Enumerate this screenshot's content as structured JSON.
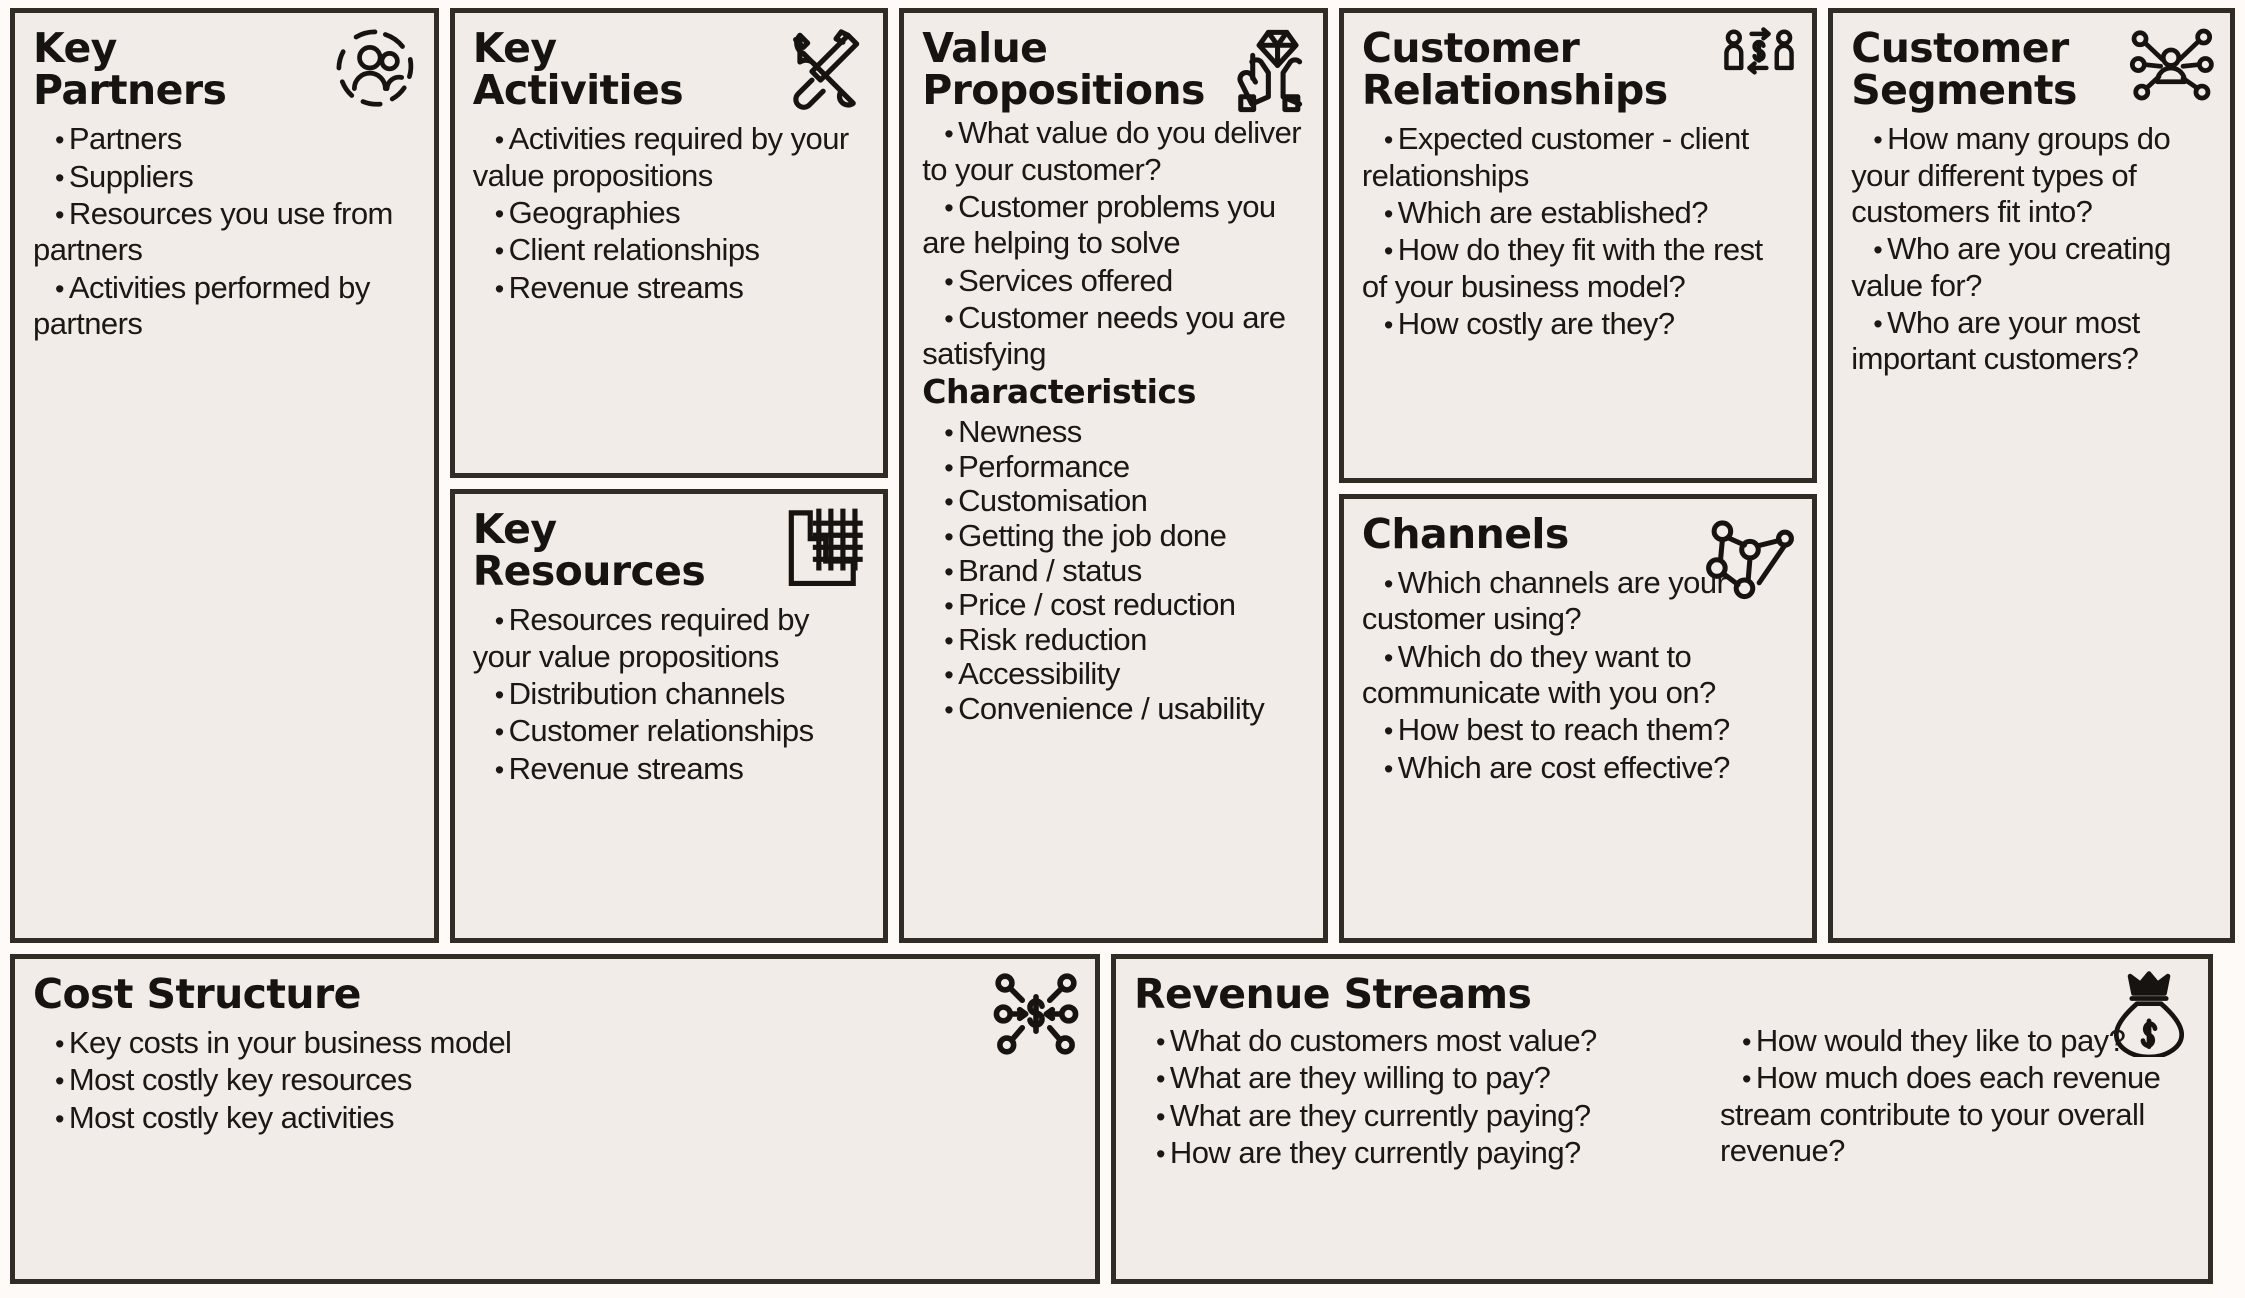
{
  "canvas": {
    "name": "Business Model Canvas",
    "background_color": "#fdfaf7",
    "block_background_color": "#f1ece8",
    "border_color": "#322c27",
    "text_color": "#1b1714"
  },
  "blocks": {
    "key_partners": {
      "title": "Key\nPartners",
      "icon": "group-of-people-in-circle-icon",
      "items": [
        "Partners",
        "Suppliers",
        "Resources you use from partners",
        "Activities performed by partners"
      ]
    },
    "key_activities": {
      "title": "Key\nActivities",
      "icon": "crossed-wrench-and-screwdriver-icon",
      "items": [
        "Activities required by your value propositions",
        "Geographies",
        "Client relationships",
        "Revenue streams"
      ]
    },
    "key_resources": {
      "title": "Key\nResources",
      "icon": "factory-grid-icon",
      "items": [
        "Resources required by your value propositions",
        "Distribution channels",
        "Customer relationships",
        "Revenue streams"
      ]
    },
    "value_propositions": {
      "title": "Value\nPropositions",
      "icon": "diamond-in-hands-icon",
      "items": [
        "What value do you deliver to your customer?",
        "Customer problems you are helping to solve",
        "Services offered",
        "Customer needs you are satisfying"
      ],
      "subheading": "Characteristics",
      "characteristics": [
        "Newness",
        "Performance",
        "Customisation",
        "Getting the job done",
        "Brand / status",
        "Price / cost reduction",
        "Risk reduction",
        "Accessibility",
        "Convenience / usability"
      ]
    },
    "customer_relationships": {
      "title": "Customer\nRelationships",
      "icon": "two-people-exchange-money-icon",
      "items": [
        "Expected customer - client relationships",
        "Which are established?",
        "How do they fit with the rest of your business model?",
        "How costly are they?"
      ]
    },
    "channels": {
      "title": "Channels",
      "icon": "network-nodes-icon",
      "items": [
        "Which channels are your customer using?",
        "Which do they want to communicate with you on?",
        "How best to reach them?",
        "Which are cost effective?"
      ]
    },
    "customer_segments": {
      "title": "Customer\nSegments",
      "icon": "person-network-hub-icon",
      "items": [
        "How many groups do your different types of customers fit into?",
        "Who are you creating value for?",
        "Who are your most important customers?"
      ]
    },
    "cost_structure": {
      "title": "Cost Structure",
      "icon": "dollar-sign-network-icon",
      "items": [
        "Key costs in your business model",
        "Most costly key resources",
        "Most costly key activities"
      ]
    },
    "revenue_streams": {
      "title": "Revenue Streams",
      "icon": "crowned-money-bag-icon",
      "items_left": [
        "What do customers most value?",
        "What are they willing to pay?",
        "What are they currently paying?",
        "How are they currently paying?"
      ],
      "items_right": [
        "How would they like to pay?",
        "How much does each revenue stream contribute to your overall revenue?"
      ]
    }
  }
}
